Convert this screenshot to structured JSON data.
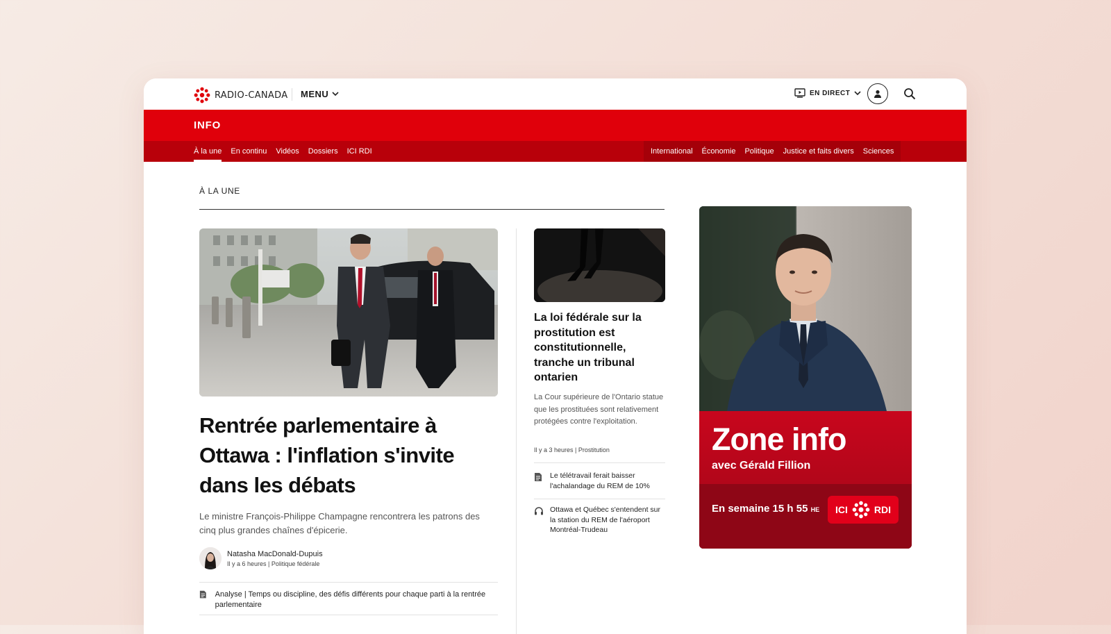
{
  "header": {
    "logo_text": "RADIO-CANADA",
    "menu_label": "MENU",
    "live_label": "EN DIRECT"
  },
  "section": {
    "title": "INFO",
    "primary_nav": [
      "À la une",
      "En continu",
      "Vidéos",
      "Dossiers",
      "ICI RDI"
    ],
    "topic_nav": [
      "International",
      "Économie",
      "Politique",
      "Justice et faits divers",
      "Sciences"
    ]
  },
  "content": {
    "kicker": "À LA UNE",
    "main": {
      "title": "Rentrée parlementaire à Ottawa : l'inflation s'invite dans les débats",
      "summary": "Le ministre François-Philippe Champagne rencontrera les patrons des cinq plus grandes chaînes d'épicerie.",
      "author": "Natasha MacDonald-Dupuis",
      "meta": "Il y a 6 heures | Politique fédérale",
      "related": "Analyse | Temps ou discipline, des défis différents pour chaque parti à la rentrée parlementaire"
    },
    "side": {
      "title": "La loi fédérale sur la prostitution est constitutionnelle, tranche un tribunal ontarien",
      "summary": "La Cour supérieure de l'Ontario statue que les prostituées sont relativement protégées contre l'exploitation.",
      "meta": "Il y a 3 heures | Prostitution",
      "related": [
        {
          "icon": "article-icon",
          "text": "Le télétravail ferait baisser l'achalandage du REM de 10%"
        },
        {
          "icon": "headphones-icon",
          "text": "Ottawa et Québec s'entendent sur la station du REM de l'aéroport Montréal-Trudeau"
        }
      ]
    }
  },
  "ad": {
    "title": "Zone info",
    "subtitle": "avec Gérald Fillion",
    "schedule": "En semaine 15 h 55",
    "schedule_suffix": "HE",
    "badge_left": "ICI",
    "badge_right": "RDI"
  },
  "colors": {
    "brand_red": "#e0000b",
    "subnav_red": "#b8000a",
    "text": "#111111"
  }
}
